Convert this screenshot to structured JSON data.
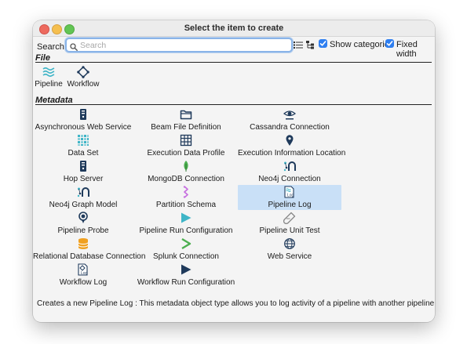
{
  "window": {
    "title": "Select the item to create"
  },
  "toolbar": {
    "search_label": "Search:",
    "search_placeholder": "Search",
    "search_value": "",
    "show_categories_label": "Show categories",
    "show_categories_checked": true,
    "fixed_width_label": "Fixed width",
    "fixed_width_checked": true,
    "list_view_icon": "list-view-icon",
    "tree_view_icon": "tree-view-icon"
  },
  "sections": {
    "file": {
      "title": "File",
      "items": [
        {
          "label": "Pipeline",
          "icon": "pipeline-icon"
        },
        {
          "label": "Workflow",
          "icon": "workflow-icon"
        }
      ]
    },
    "metadata": {
      "title": "Metadata",
      "items": [
        {
          "label": "Asynchronous Web Service",
          "icon": "async-web-service-icon"
        },
        {
          "label": "Beam File Definition",
          "icon": "folder-icon"
        },
        {
          "label": "Cassandra Connection",
          "icon": "cassandra-eye-icon"
        },
        {
          "label": "Data Set",
          "icon": "data-set-icon"
        },
        {
          "label": "Execution Data Profile",
          "icon": "data-profile-grid-icon"
        },
        {
          "label": "Execution Information Location",
          "icon": "location-pin-icon"
        },
        {
          "label": "Hop Server",
          "icon": "server-icon"
        },
        {
          "label": "MongoDB Connection",
          "icon": "mongodb-leaf-icon"
        },
        {
          "label": "Neo4j Connection",
          "icon": "neo4j-icon"
        },
        {
          "label": "Neo4j Graph Model",
          "icon": "neo4j-graph-icon"
        },
        {
          "label": "Partition Schema",
          "icon": "partition-icon"
        },
        {
          "label": "Pipeline Log",
          "icon": "pipeline-log-icon"
        },
        {
          "label": "Pipeline Probe",
          "icon": "probe-icon"
        },
        {
          "label": "Pipeline Run Configuration",
          "icon": "play-triangle-icon"
        },
        {
          "label": "Pipeline Unit Test",
          "icon": "test-tube-icon"
        },
        {
          "label": "Relational Database Connection",
          "icon": "database-icon"
        },
        {
          "label": "Splunk Connection",
          "icon": "splunk-chevron-icon"
        },
        {
          "label": "Web Service",
          "icon": "web-service-globe-icon"
        },
        {
          "label": "Workflow Log",
          "icon": "workflow-log-icon"
        },
        {
          "label": "Workflow Run Configuration",
          "icon": "play-dark-icon"
        }
      ],
      "selected": "Pipeline Log"
    }
  },
  "status": {
    "text": "Creates a new Pipeline Log : This metadata object type allows you to log activity of a pipeline with another pipeline"
  },
  "colors": {
    "selection": "#c9e0f7",
    "accent": "#2f7ff0",
    "focus_ring": "#8ab4e8",
    "icon_teal": "#3fb5c7",
    "icon_navy": "#1f3a5b",
    "icon_orange": "#f0a020"
  }
}
